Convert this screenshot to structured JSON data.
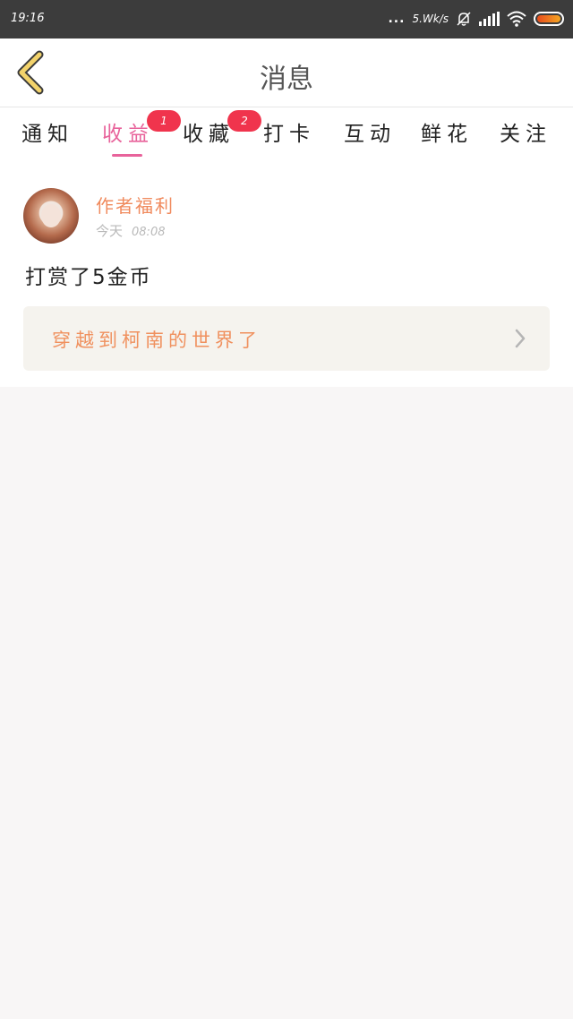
{
  "status_bar": {
    "time": "19:16",
    "dots": "...",
    "net_speed": "5.Wk/s",
    "icons": [
      "mute-bell-icon",
      "signal-icon",
      "wifi-icon",
      "battery-icon"
    ]
  },
  "header": {
    "back_icon": "chevron-left-icon",
    "title": "消息"
  },
  "tabs": [
    {
      "label": "通知",
      "badge": ""
    },
    {
      "label": "收益",
      "badge": "1",
      "active": true
    },
    {
      "label": "收藏",
      "badge": "2"
    },
    {
      "label": "打卡",
      "badge": ""
    },
    {
      "label": "互动",
      "badge": ""
    },
    {
      "label": "鲜花",
      "badge": ""
    },
    {
      "label": "关注",
      "badge": ""
    }
  ],
  "message": {
    "author": "作者福利",
    "date": "今天",
    "time": "08:08",
    "text": "打赏了5金币",
    "linked_work": "穿越到柯南的世界了",
    "linked_icon": "chevron-right-icon"
  },
  "colors": {
    "accent": "#e8639b",
    "badge": "#f0344d",
    "author": "#f08a5d",
    "back_icon": "#f3d36b"
  }
}
